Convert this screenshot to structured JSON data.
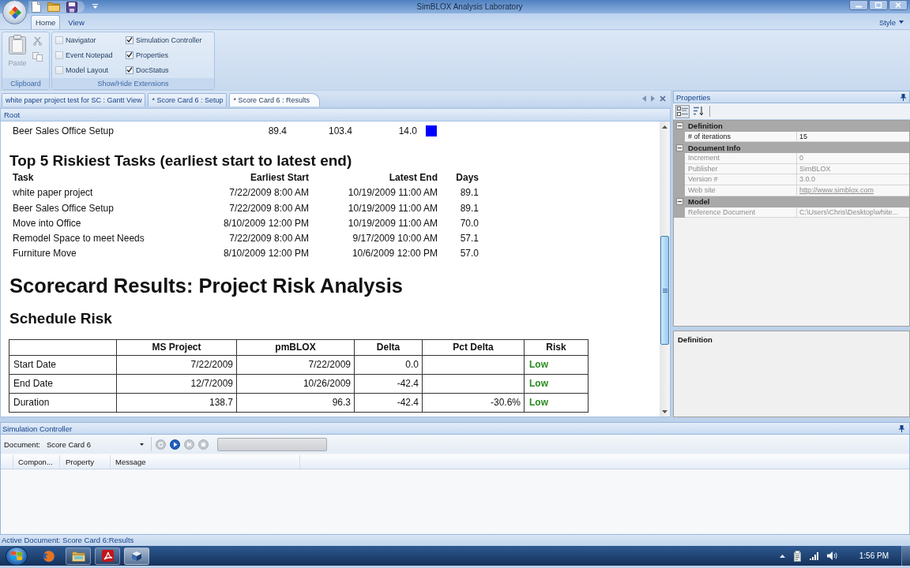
{
  "window": {
    "title": "SimBLOX Analysis Laboratory"
  },
  "ribbon": {
    "tabs": [
      {
        "label": "Home",
        "selected": true
      },
      {
        "label": "View",
        "selected": false
      }
    ],
    "style_menu": {
      "label": "Style"
    },
    "clipboard": {
      "label": "Clipboard",
      "paste": {
        "label": "Paste",
        "disabled": true
      },
      "tools": [
        {
          "kind": "cut",
          "disabled": true
        },
        {
          "kind": "copy",
          "disabled": true
        }
      ]
    },
    "extensions": {
      "label": "Show/Hide Extensions",
      "checkboxes": [
        {
          "label": "Navigator",
          "checked": false
        },
        {
          "label": "Event Notepad",
          "checked": false
        },
        {
          "label": "Model Layout",
          "checked": false
        },
        {
          "label": "Simulation Controller",
          "checked": true
        },
        {
          "label": "Properties",
          "checked": true
        },
        {
          "label": "DocStatus",
          "checked": true
        }
      ]
    }
  },
  "documents": {
    "tabs": [
      {
        "label": "white paper project test for SC : Gantt View",
        "selected": false
      },
      {
        "label": "* Score Card 6 : Setup",
        "selected": false
      },
      {
        "label": "* Score Card 6 : Results",
        "selected": true
      }
    ],
    "breadcrumb": "Root",
    "report": {
      "summary_row": {
        "task": "Beer Sales Office Setup",
        "values": [
          "89.4",
          "103.4",
          "14.0"
        ],
        "color": "#0000ff"
      },
      "riskiest": {
        "title": "Top 5 Riskiest Tasks (earliest start to latest end)",
        "columns": [
          "Task",
          "Earliest Start",
          "Latest End",
          "Days"
        ],
        "rows": [
          [
            "white paper project",
            "7/22/2009 8:00 AM",
            "10/19/2009 11:00 AM",
            "89.1"
          ],
          [
            "Beer Sales Office Setup",
            "7/22/2009 8:00 AM",
            "10/19/2009 11:00 AM",
            "89.1"
          ],
          [
            "Move into Office",
            "8/10/2009 12:00 PM",
            "10/19/2009 11:00 AM",
            "70.0"
          ],
          [
            "Remodel Space to meet Needs",
            "7/22/2009 8:00 AM",
            "9/17/2009 10:00 AM",
            "57.1"
          ],
          [
            "Furniture Move",
            "8/10/2009 12:00 PM",
            "10/6/2009 12:00 PM",
            "57.0"
          ]
        ]
      },
      "title": "Scorecard Results: Project Risk Analysis",
      "schedule": {
        "title": "Schedule Risk",
        "columns": [
          "MS Project",
          "pmBLOX",
          "Delta",
          "Pct Delta",
          "Risk"
        ],
        "rows": [
          {
            "label": "Start Date",
            "ms_project": "7/22/2009",
            "pmblox": "7/22/2009",
            "delta": "0.0",
            "risk": "Low"
          },
          {
            "label": "End Date",
            "ms_project": "12/7/2009",
            "pmblox": "10/26/2009",
            "delta": "-42.4",
            "risk": "Low"
          },
          {
            "label": "Duration",
            "ms_project": "138.7",
            "pmblox": "96.3",
            "delta": "-42.4",
            "pct_delta": "-30.6%",
            "risk": "Low"
          }
        ]
      }
    }
  },
  "properties": {
    "title": "Properties",
    "toolbar": [
      {
        "kind": "categorized",
        "selected": true
      },
      {
        "kind": "alphabetical",
        "selected": false
      }
    ],
    "categories": [
      {
        "label": "Definition",
        "expanded": true,
        "items": [
          {
            "name": "# of iterations",
            "value": "15",
            "read_only": false,
            "kind": "text"
          }
        ]
      },
      {
        "label": "Document Info",
        "expanded": true,
        "items": [
          {
            "name": "Increment",
            "value": "0",
            "read_only": true,
            "kind": "text"
          },
          {
            "name": "Publisher",
            "value": "SimBLOX",
            "read_only": true,
            "kind": "text"
          },
          {
            "name": "Version #",
            "value": "3.0.0",
            "read_only": true,
            "kind": "text"
          },
          {
            "name": "Web site",
            "value": "http://www.simblox.com",
            "read_only": true,
            "kind": "link"
          }
        ]
      },
      {
        "label": "Model",
        "expanded": true,
        "items": [
          {
            "name": "Reference Document",
            "value": "C:\\Users\\Chris\\Desktop\\white...",
            "read_only": true,
            "kind": "text"
          }
        ]
      }
    ],
    "description": {
      "title": "Definition"
    }
  },
  "simulation_controller": {
    "title": "Simulation Controller",
    "document_label": "Document:",
    "document": "Score Card 6",
    "buttons": [
      {
        "kind": "reset",
        "disabled": true
      },
      {
        "kind": "play",
        "disabled": false
      },
      {
        "kind": "step",
        "disabled": true
      },
      {
        "kind": "stop",
        "disabled": true
      }
    ],
    "progress": {
      "level": 0
    },
    "columns": [
      "Compon...",
      "Property",
      "Message"
    ]
  },
  "status_bar": {
    "text": "Active Document: Score Card 6:Results"
  },
  "taskbar": {
    "items": [
      {
        "kind": "browser",
        "running": false,
        "active": false
      },
      {
        "kind": "folder",
        "running": true,
        "active": false
      },
      {
        "kind": "pdf",
        "running": true,
        "active": false
      },
      {
        "kind": "app",
        "running": true,
        "active": true
      }
    ],
    "clock": "1:56 PM"
  }
}
